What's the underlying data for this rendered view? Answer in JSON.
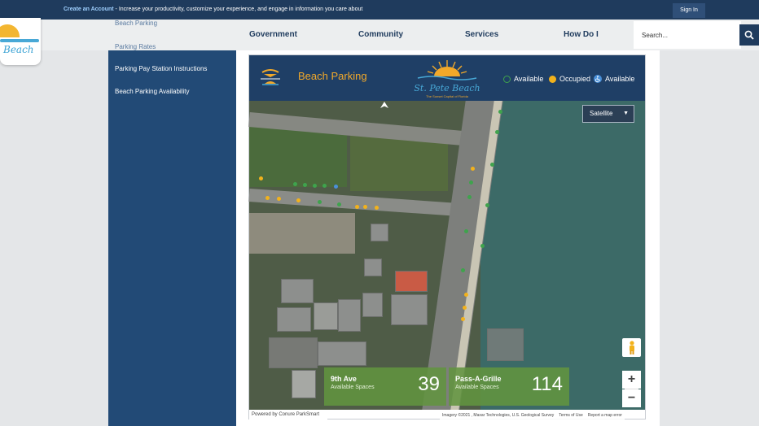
{
  "topbar": {
    "create_account": "Create an Account",
    "message": " - Increase your productivity, customize your experience, and engage in information you care about",
    "sign_in": "Sign In"
  },
  "logo": {
    "text": "Beach"
  },
  "nav": {
    "items": [
      "Government",
      "Community",
      "Services",
      "How Do I"
    ]
  },
  "search": {
    "placeholder": "Search..."
  },
  "sidebar": {
    "ghost_items": [
      "Beach Parking",
      "Parking Rates"
    ],
    "items": [
      "Parking Pay Station Instructions",
      "Beach Parking Availability"
    ]
  },
  "widget": {
    "title": "Beach Parking",
    "brand": "St. Pete Beach",
    "tagline": "The Sunset Capital of Florida",
    "legend": [
      {
        "label": "Available",
        "color": "#3fa34d",
        "icon": "circle"
      },
      {
        "label": "Occupied",
        "color": "#f2b21c",
        "icon": "circle"
      },
      {
        "label": "Available",
        "color": "#4a90d9",
        "icon": "wheelchair-icon"
      }
    ]
  },
  "map": {
    "type_selected": "Satellite",
    "counts": [
      {
        "name": "9th Ave",
        "sub": "Available Spaces",
        "value": "39"
      },
      {
        "name": "Pass-A-Grille",
        "sub": "Available Spaces",
        "value": "114"
      }
    ],
    "zoom_in": "+",
    "zoom_out": "−",
    "powered_by": "Powered by Conure ParkSmart",
    "attribution": [
      "Imagery ©2021 , Maxar Technologies, U.S. Geological Survey",
      "Terms of Use",
      "Report a map error"
    ]
  },
  "colors": {
    "navy": "#1f3b5d",
    "accent_orange": "#f2a92a",
    "card_green": "#629440"
  }
}
